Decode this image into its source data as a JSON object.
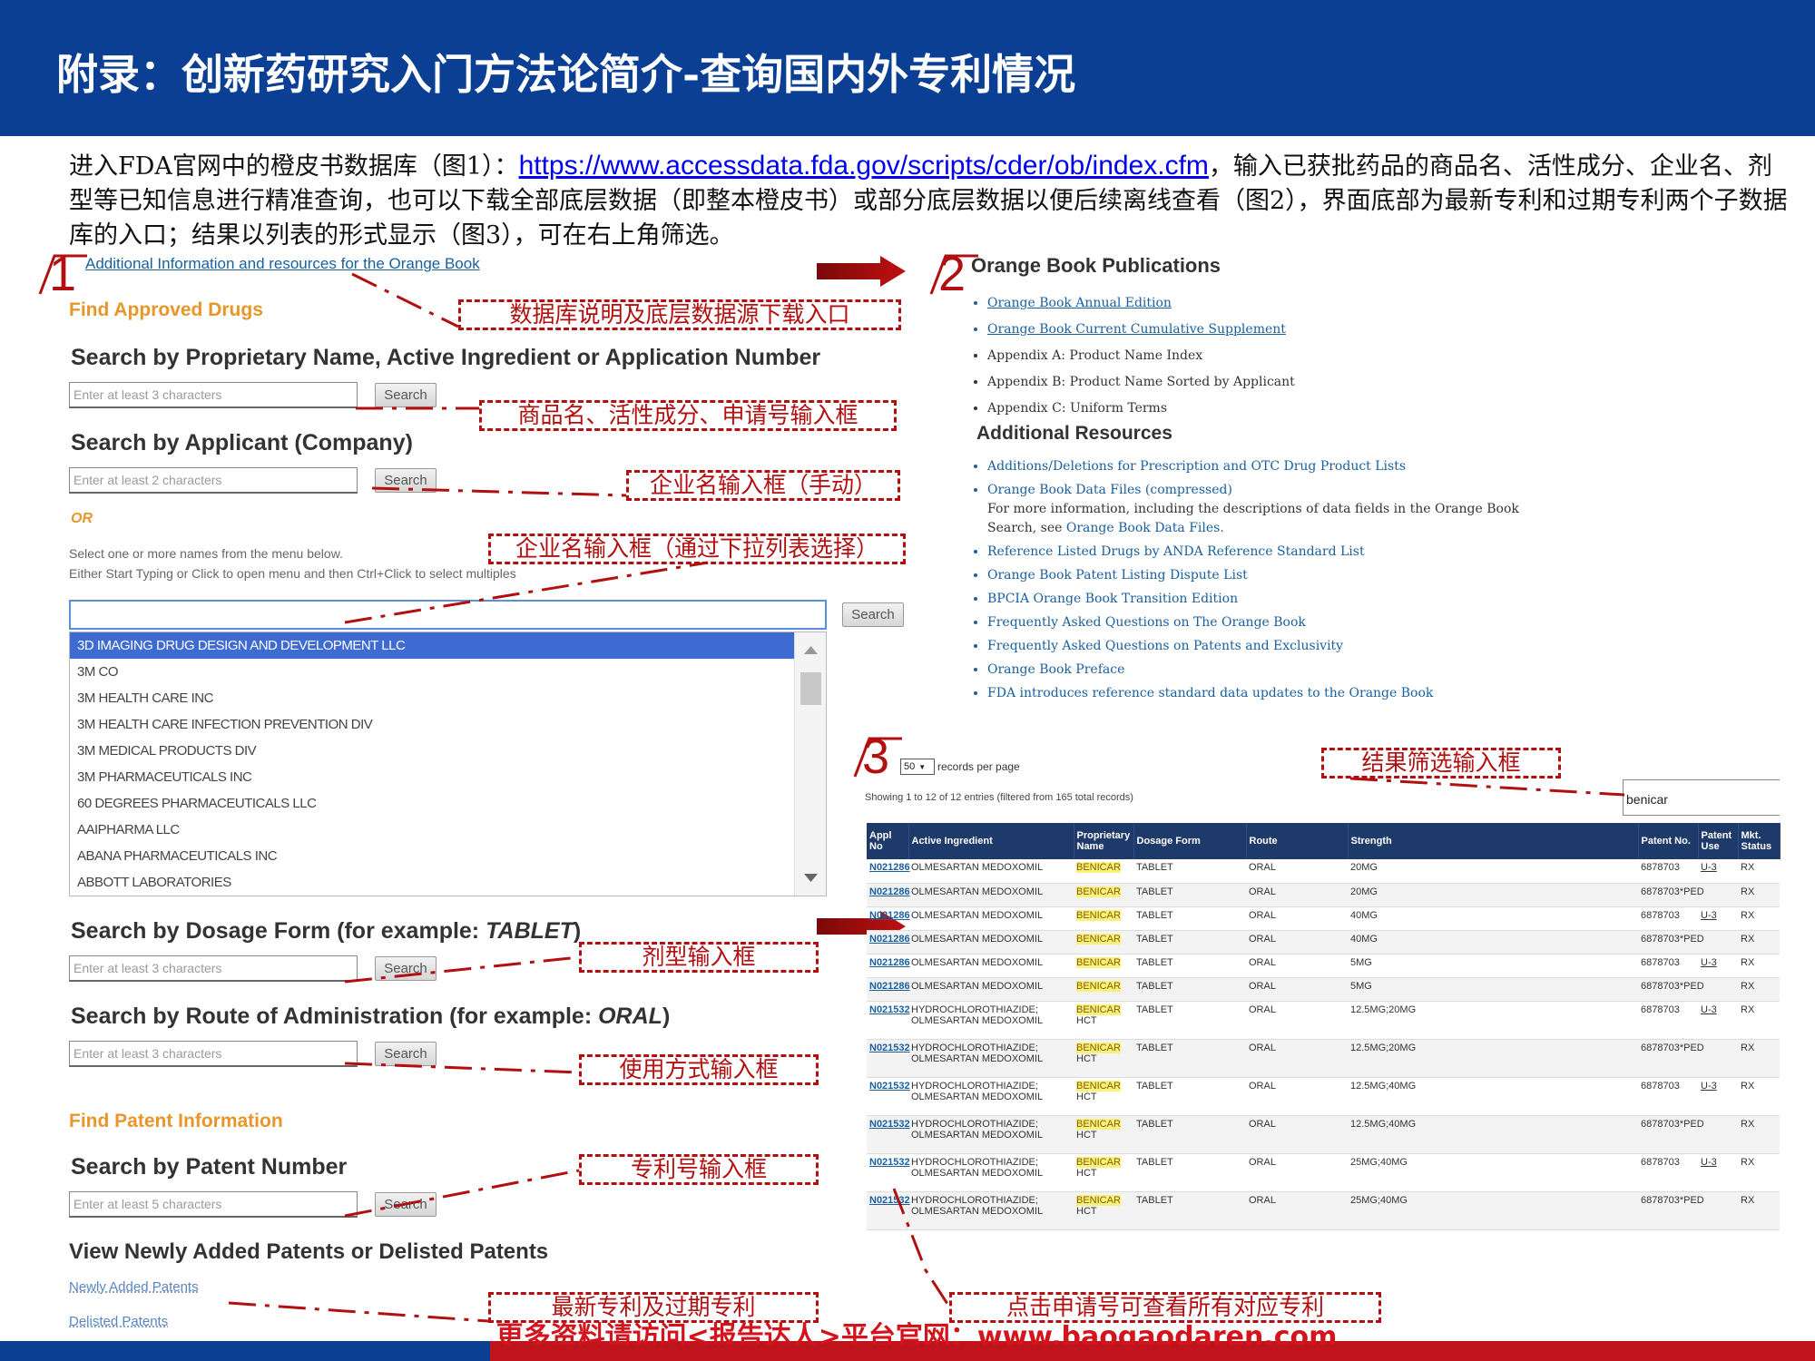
{
  "title": "附录：创新药研究入门方法论简介-查询国内外专利情况",
  "intro": {
    "part1": "进入FDA官网中的橙皮书数据库（图1）：",
    "link": "https://www.accessdata.fda.gov/scripts/cder/ob/index.cfm",
    "part2": "，输入已获批药品的商品名、活性成分、企业名、剂型等已知信息进行精准查询，也可以下载全部底层数据（即整本橙皮书）或部分底层数据以便后续离线查看（图2），界面底部为最新专利和过期专利两个子数据库的入口；结果以列表的形式显示（图3），可在右上角筛选。"
  },
  "badges": {
    "one": "1",
    "two": "2",
    "three": "3"
  },
  "panel1": {
    "top_link": "Additional Information and resources for the Orange Book",
    "find_drugs": "Find Approved Drugs",
    "search_name_heading": "Search by Proprietary Name, Active Ingredient or Application Number",
    "search_name_placeholder": "Enter at least 3 characters",
    "search_label": "Search",
    "search_applicant_heading": "Search by Applicant (Company)",
    "search_applicant_placeholder": "Enter at least 2 characters",
    "or_label": "OR",
    "select_hint_1": "Select one or more names from the menu below.",
    "select_hint_2": "Either Start Typing or Click to open menu and then Ctrl+Click to select multiples",
    "companies": [
      "3D IMAGING DRUG DESIGN AND DEVELOPMENT LLC",
      "3M CO",
      "3M HEALTH CARE INC",
      "3M HEALTH CARE INFECTION PREVENTION DIV",
      "3M MEDICAL PRODUCTS DIV",
      "3M PHARMACEUTICALS INC",
      "60 DEGREES PHARMACEUTICALS LLC",
      "AAIPHARMA LLC",
      "ABANA PHARMACEUTICALS INC",
      "ABBOTT LABORATORIES"
    ],
    "dosage_heading_a": "Search by Dosage Form (for example: ",
    "dosage_heading_em": "TABLET",
    "dosage_heading_b": ")",
    "dosage_placeholder": "Enter at least 3 characters",
    "route_heading_a": "Search by Route of Administration (for example: ",
    "route_heading_em": "ORAL",
    "route_heading_b": ")",
    "route_placeholder": "Enter at least 3 characters",
    "find_patent": "Find Patent Information",
    "patent_heading": "Search by Patent Number",
    "patent_placeholder": "Enter at least 5 characters",
    "view_new_heading": "View Newly Added Patents or Delisted Patents",
    "newly_added": "Newly Added Patents",
    "delisted": "Delisted Patents"
  },
  "panel2": {
    "publications_heading": "Orange Book Publications",
    "publications": [
      "Orange Book Annual Edition",
      "Orange Book Current Cumulative Supplement",
      "Appendix A: Product Name Index",
      "Appendix B: Product Name Sorted by Applicant",
      "Appendix C: Uniform Terms"
    ],
    "resources_heading": "Additional Resources",
    "res_1": "Additions/Deletions for Prescription and OTC Drug Product Lists",
    "res_2": "Orange Book Data Files (compressed)",
    "res_2_note_a": "For more information, including the descriptions of data fields in the Orange Book",
    "res_2_note_b": "Search, see ",
    "res_2_note_link": "Orange Book Data Files.",
    "resources_rest": [
      "Reference Listed Drugs by ANDA Reference Standard List",
      "Orange Book Patent Listing Dispute List",
      "BPCIA Orange Book Transition Edition",
      "Frequently Asked Questions on The Orange Book",
      "Frequently Asked Questions on Patents and Exclusivity",
      "Orange Book Preface",
      "FDA introduces reference standard data updates to the Orange Book"
    ]
  },
  "panel3": {
    "records_value": "50",
    "records_label": "records per page",
    "showing": "Showing 1 to 12 of 12 entries (filtered from 165 total records)",
    "filter_value": "benicar",
    "headers": [
      "Appl No",
      "Active Ingredient",
      "Proprietary Name",
      "Dosage Form",
      "Route",
      "Strength",
      "Patent No.",
      "Patent Use",
      "Mkt. Status"
    ],
    "rows": [
      [
        "N021286",
        "OLMESARTAN MEDOXOMIL",
        "BENICAR",
        "",
        "TABLET",
        "ORAL",
        "20MG",
        "6878703",
        "U-3",
        "RX"
      ],
      [
        "N021286",
        "OLMESARTAN MEDOXOMIL",
        "BENICAR",
        "",
        "TABLET",
        "ORAL",
        "20MG",
        "6878703*PED",
        "",
        "RX"
      ],
      [
        "N021286",
        "OLMESARTAN MEDOXOMIL",
        "BENICAR",
        "",
        "TABLET",
        "ORAL",
        "40MG",
        "6878703",
        "U-3",
        "RX"
      ],
      [
        "N021286",
        "OLMESARTAN MEDOXOMIL",
        "BENICAR",
        "",
        "TABLET",
        "ORAL",
        "40MG",
        "6878703*PED",
        "",
        "RX"
      ],
      [
        "N021286",
        "OLMESARTAN MEDOXOMIL",
        "BENICAR",
        "",
        "TABLET",
        "ORAL",
        "5MG",
        "6878703",
        "U-3",
        "RX"
      ],
      [
        "N021286",
        "OLMESARTAN MEDOXOMIL",
        "BENICAR",
        "",
        "TABLET",
        "ORAL",
        "5MG",
        "6878703*PED",
        "",
        "RX"
      ],
      [
        "N021532",
        "HYDROCHLOROTHIAZIDE; OLMESARTAN MEDOXOMIL",
        "BENICAR",
        "HCT",
        "TABLET",
        "ORAL",
        "12.5MG;20MG",
        "6878703",
        "U-3",
        "RX"
      ],
      [
        "N021532",
        "HYDROCHLOROTHIAZIDE; OLMESARTAN MEDOXOMIL",
        "BENICAR",
        "HCT",
        "TABLET",
        "ORAL",
        "12.5MG;20MG",
        "6878703*PED",
        "",
        "RX"
      ],
      [
        "N021532",
        "HYDROCHLOROTHIAZIDE; OLMESARTAN MEDOXOMIL",
        "BENICAR",
        "HCT",
        "TABLET",
        "ORAL",
        "12.5MG;40MG",
        "6878703",
        "U-3",
        "RX"
      ],
      [
        "N021532",
        "HYDROCHLOROTHIAZIDE; OLMESARTAN MEDOXOMIL",
        "BENICAR",
        "HCT",
        "TABLET",
        "ORAL",
        "12.5MG;40MG",
        "6878703*PED",
        "",
        "RX"
      ],
      [
        "N021532",
        "HYDROCHLOROTHIAZIDE; OLMESARTAN MEDOXOMIL",
        "BENICAR",
        "HCT",
        "TABLET",
        "ORAL",
        "25MG;40MG",
        "6878703",
        "U-3",
        "RX"
      ],
      [
        "N021532",
        "HYDROCHLOROTHIAZIDE; OLMESARTAN MEDOXOMIL",
        "BENICAR",
        "HCT",
        "TABLET",
        "ORAL",
        "25MG;40MG",
        "6878703*PED",
        "",
        "RX"
      ]
    ]
  },
  "callouts": {
    "db_desc": "数据库说明及底层数据源下载入口",
    "name_input": "商品名、活性成分、申请号输入框",
    "company_manual": "企业名输入框（手动）",
    "company_dropdown": "企业名输入框（通过下拉列表选择）",
    "dosage_input": "剂型输入框",
    "route_input": "使用方式输入框",
    "patent_input": "专利号输入框",
    "new_expired": "最新专利及过期专利",
    "result_filter": "结果筛选输入框",
    "click_appl": "点击申请号可查看所有对应专利"
  },
  "footer": "更多资料请访问<报告达人>平台官网：www.baogaodaren.com",
  "colors": {
    "header_blue": "#0b3f94",
    "annotation_red": "#b20f10",
    "fda_orange": "#e8962a",
    "table_header": "#1d3a6b"
  }
}
